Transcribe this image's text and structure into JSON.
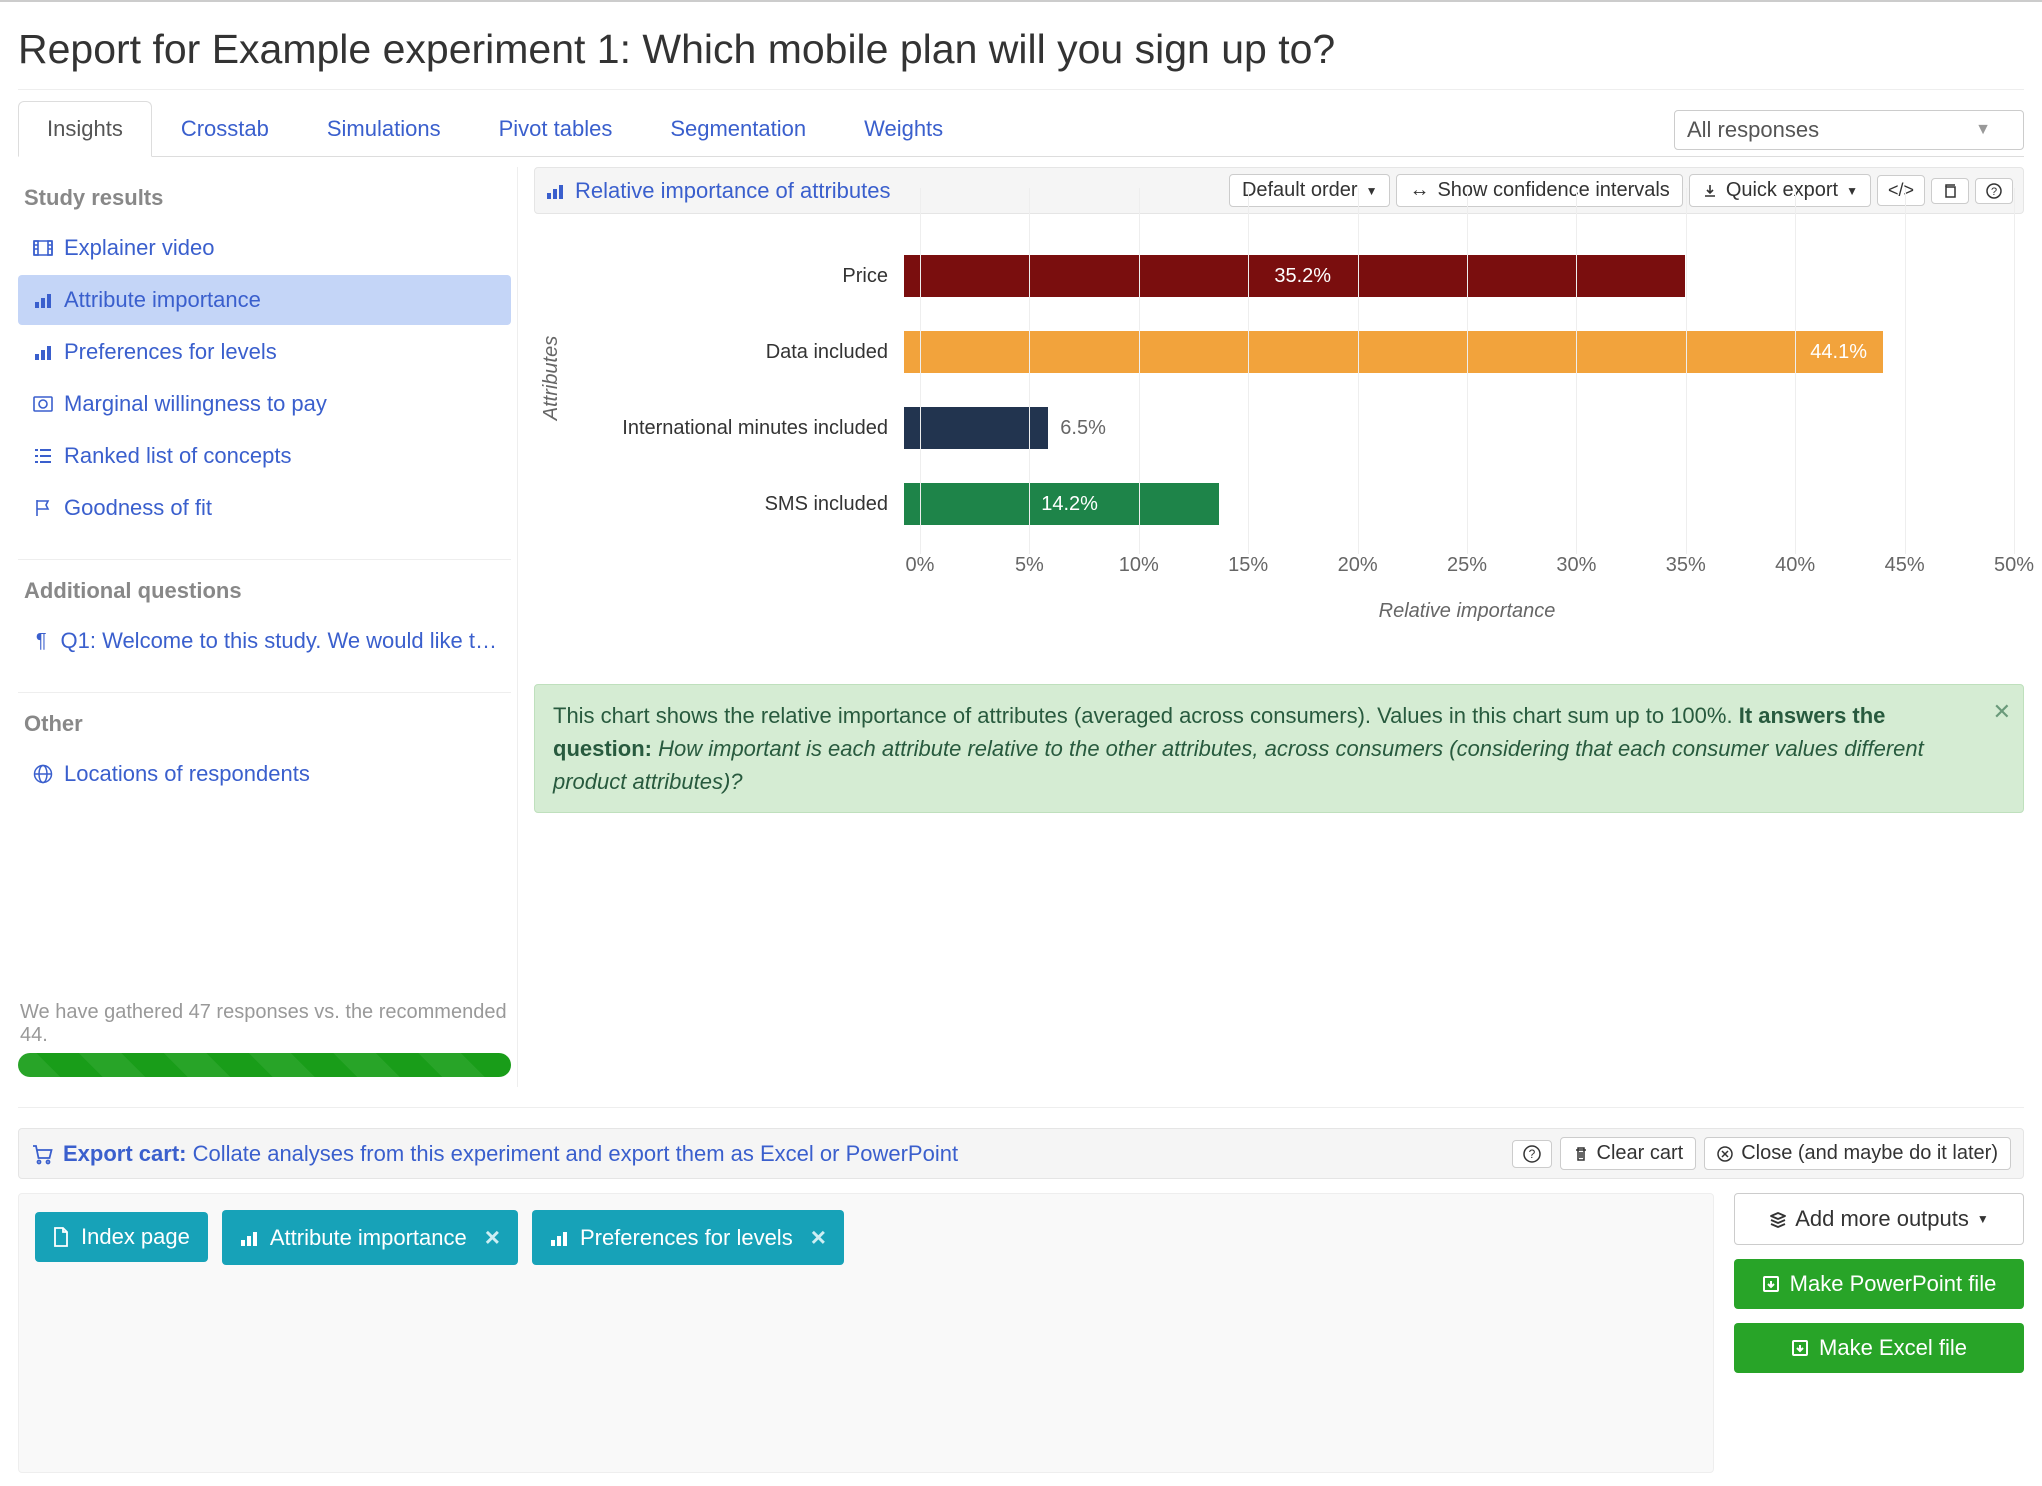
{
  "page_title": "Report for Example experiment 1: Which mobile plan will you sign up to?",
  "tabs": [
    "Insights",
    "Crosstab",
    "Simulations",
    "Pivot tables",
    "Segmentation",
    "Weights"
  ],
  "active_tab": 0,
  "response_select": "All responses",
  "sidebar": {
    "study_results_head": "Study results",
    "items": [
      {
        "label": "Explainer video",
        "icon": "video"
      },
      {
        "label": "Attribute importance",
        "icon": "bar"
      },
      {
        "label": "Preferences for levels",
        "icon": "bar"
      },
      {
        "label": "Marginal willingness to pay",
        "icon": "money"
      },
      {
        "label": "Ranked list of concepts",
        "icon": "list"
      },
      {
        "label": "Goodness of fit",
        "icon": "flag"
      }
    ],
    "active_index": 1,
    "additional_head": "Additional questions",
    "additional_item": "Q1: Welcome to this study. We would like t…",
    "other_head": "Other",
    "other_item": "Locations of respondents",
    "gather_text": "We have gathered 47 responses vs. the recommended 44."
  },
  "chart_header": {
    "title": "Relative importance of attributes",
    "default_order": "Default order",
    "confidence": "Show confidence intervals",
    "quick_export": "Quick export"
  },
  "chart_data": {
    "type": "bar",
    "orientation": "horizontal",
    "categories": [
      "Price",
      "Data included",
      "International minutes included",
      "SMS included"
    ],
    "values": [
      35.2,
      44.1,
      6.5,
      14.2
    ],
    "colors": [
      "#7A0E0E",
      "#F2A33C",
      "#22344F",
      "#1E8449"
    ],
    "label_pos": [
      "inside-center",
      "inside-right",
      "outside",
      "inside-center"
    ],
    "xlim": [
      0,
      50
    ],
    "xticks": [
      0,
      5,
      10,
      15,
      20,
      25,
      30,
      35,
      40,
      45,
      50
    ],
    "ylabel": "Attributes",
    "xlabel": "Relative importance",
    "title": ""
  },
  "info_banner": {
    "lead": "This chart shows the relative importance of attributes (averaged across consumers). Values in this chart sum up to 100%. ",
    "strong": "It answers the question: ",
    "em": "How important is each attribute relative to the other attributes, across consumers (considering that each consumer values different product attributes)?"
  },
  "export": {
    "header_label": "Export cart:",
    "header_desc": "Collate analyses from this experiment and export them as Excel or PowerPoint",
    "clear": "Clear cart",
    "close": "Close (and maybe do it later)",
    "chips": [
      {
        "label": "Index page",
        "icon": "doc",
        "closable": false
      },
      {
        "label": "Attribute importance",
        "icon": "bar",
        "closable": true
      },
      {
        "label": "Preferences for levels",
        "icon": "bar",
        "closable": true
      }
    ],
    "add_more": "Add more outputs",
    "ppt": "Make PowerPoint file",
    "xls": "Make Excel file"
  }
}
